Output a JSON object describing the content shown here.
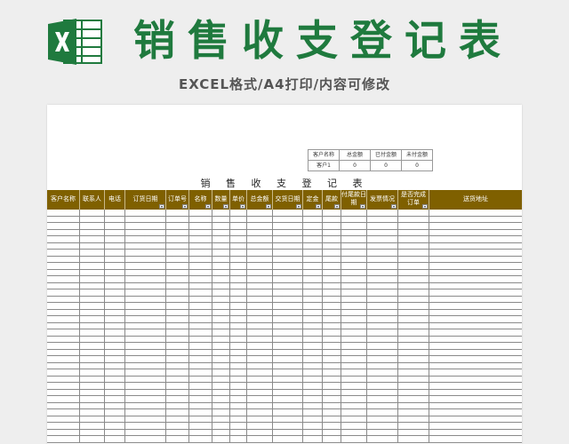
{
  "banner": {
    "title": "销售收支登记表",
    "subtitle": "EXCEL格式/A4打印/内容可修改",
    "logo_icon": "excel-icon",
    "brand_color": "#1f7a3e"
  },
  "summary": {
    "headers": [
      "客户名称",
      "总金额",
      "已付金额",
      "未付金额"
    ],
    "row": [
      "客户1",
      "0",
      "0",
      "0"
    ]
  },
  "sheet": {
    "title": "销 售 收 支 登 记 表",
    "header_color": "#7f6000",
    "columns": [
      {
        "label": "客户名称",
        "filter": false
      },
      {
        "label": "联系人",
        "filter": false
      },
      {
        "label": "电话",
        "filter": false
      },
      {
        "label": "订货日期",
        "filter": true
      },
      {
        "label": "订单号",
        "filter": true
      },
      {
        "label": "名称",
        "filter": true
      },
      {
        "label": "数量",
        "filter": true
      },
      {
        "label": "单价",
        "filter": true
      },
      {
        "label": "总金额",
        "filter": true
      },
      {
        "label": "交货日期",
        "filter": true
      },
      {
        "label": "定金",
        "filter": true
      },
      {
        "label": "尾款",
        "filter": true
      },
      {
        "label": "付尾款日期",
        "filter": true
      },
      {
        "label": "发票情况",
        "filter": true
      },
      {
        "label": "是否完成订单",
        "filter": true
      },
      {
        "label": "送货地址",
        "filter": false
      }
    ],
    "empty_rows": 35
  }
}
